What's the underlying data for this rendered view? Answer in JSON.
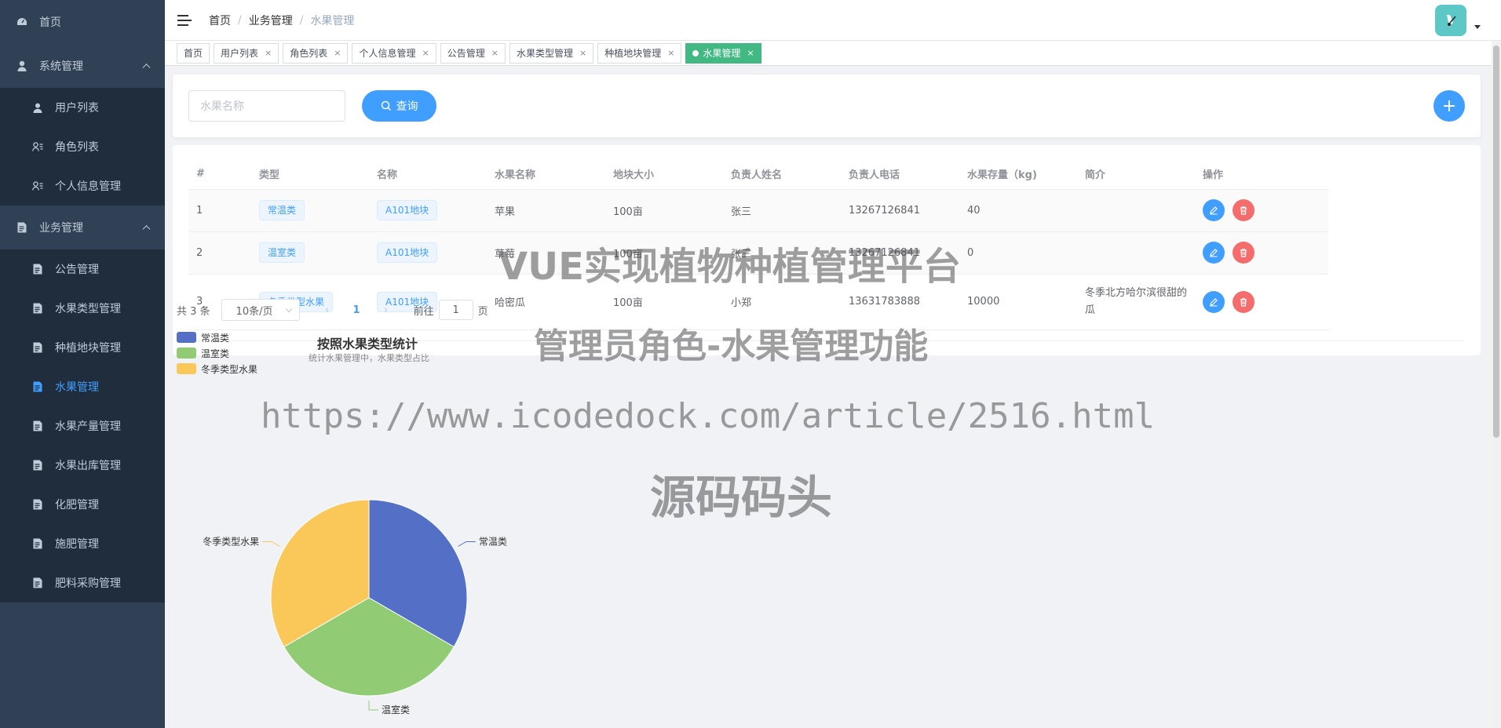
{
  "sidebar": {
    "items": [
      {
        "label": "首页",
        "icon": "dashboard-icon"
      },
      {
        "label": "系统管理",
        "icon": "user-icon",
        "expanded": true
      },
      {
        "label": "用户列表",
        "icon": "user-icon"
      },
      {
        "label": "角色列表",
        "icon": "user-list-icon"
      },
      {
        "label": "个人信息管理",
        "icon": "user-list-icon"
      },
      {
        "label": "业务管理",
        "icon": "document-icon",
        "expanded": true
      },
      {
        "label": "公告管理",
        "icon": "document-icon"
      },
      {
        "label": "水果类型管理",
        "icon": "document-icon"
      },
      {
        "label": "种植地块管理",
        "icon": "document-icon"
      },
      {
        "label": "水果管理",
        "icon": "document-icon",
        "active": true
      },
      {
        "label": "水果产量管理",
        "icon": "document-icon"
      },
      {
        "label": "水果出库管理",
        "icon": "document-icon"
      },
      {
        "label": "化肥管理",
        "icon": "document-icon"
      },
      {
        "label": "施肥管理",
        "icon": "document-icon"
      },
      {
        "label": "肥料采购管理",
        "icon": "document-icon"
      }
    ]
  },
  "breadcrumb": [
    "首页",
    "业务管理",
    "水果管理"
  ],
  "breadcrumb_sep": "/",
  "tags": [
    {
      "label": "首页"
    },
    {
      "label": "用户列表",
      "close": "×"
    },
    {
      "label": "角色列表",
      "close": "×"
    },
    {
      "label": "个人信息管理",
      "close": "×"
    },
    {
      "label": "公告管理",
      "close": "×"
    },
    {
      "label": "水果类型管理",
      "close": "×"
    },
    {
      "label": "种植地块管理",
      "close": "×"
    },
    {
      "label": "水果管理",
      "close": "×",
      "active": true
    }
  ],
  "search": {
    "placeholder": "水果名称",
    "button_label": "查询",
    "add_label": "+"
  },
  "table": {
    "headers": [
      "#",
      "类型",
      "名称",
      "水果名称",
      "地块大小",
      "负责人姓名",
      "负责人电话",
      "水果存量（kg)",
      "简介",
      "操作"
    ],
    "rows": [
      {
        "idx": "1",
        "type": "常温类",
        "name": "A101地块",
        "fruit": "苹果",
        "size": "100亩",
        "owner": "张三",
        "phone": "13267126841",
        "stock": "40",
        "intro": ""
      },
      {
        "idx": "2",
        "type": "温室类",
        "name": "A101地块",
        "fruit": "草莓",
        "size": "100亩",
        "owner": "张三",
        "phone": "13267126841",
        "stock": "0",
        "intro": ""
      },
      {
        "idx": "3",
        "type": "冬季类型水果",
        "name": "A101地块",
        "fruit": "哈密瓜",
        "size": "100亩",
        "owner": "小郑",
        "phone": "13631783888",
        "stock": "10000",
        "intro": "冬季北方哈尔滨很甜的瓜"
      }
    ]
  },
  "pagination": {
    "total": "共 3 条",
    "page_size": "10条/页",
    "prev": "‹",
    "current": "1",
    "next": "›",
    "goto_label": "前往",
    "goto_value": "1",
    "page_suffix": "页"
  },
  "chart_data": {
    "type": "pie",
    "title": "按照水果类型统计",
    "subtitle": "统计水果管理中，水果类型占比",
    "categories": [
      "常温类",
      "温室类",
      "冬季类型水果"
    ],
    "values": [
      1,
      1,
      1
    ],
    "colors": [
      "#5470c6",
      "#91cc75",
      "#fac858"
    ],
    "legend_position": "top-left"
  },
  "watermark": {
    "line1": "VUE实现植物种植管理平台",
    "line2": "管理员角色-水果管理功能",
    "line3": "https://www.icodedock.com/article/2516.html",
    "line4": "源码码头"
  },
  "colors": {
    "sidebar_bg": "#304156",
    "accent": "#409eff",
    "tag_active": "#42b983",
    "danger": "#f56c6c"
  }
}
